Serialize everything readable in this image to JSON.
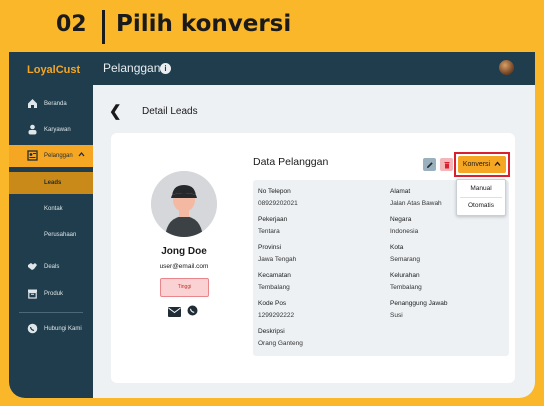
{
  "banner": {
    "step_number": "02",
    "title": "Pilih konversi"
  },
  "topbar": {
    "logo": "LoyalCust",
    "title": "Pelanggan"
  },
  "sidebar": {
    "items": [
      {
        "label": "Beranda",
        "icon": "home-icon"
      },
      {
        "label": "Karyawan",
        "icon": "users-icon"
      },
      {
        "label": "Pelanggan",
        "icon": "customer-icon"
      },
      {
        "label": "Leads",
        "icon": ""
      },
      {
        "label": "Kontak",
        "icon": ""
      },
      {
        "label": "Perusahaan",
        "icon": ""
      },
      {
        "label": "Deals",
        "icon": "handshake-icon"
      },
      {
        "label": "Produk",
        "icon": "box-icon"
      },
      {
        "label": "Hubungi Kami",
        "icon": "chat-icon"
      }
    ]
  },
  "page": {
    "title": "Detail Leads",
    "back": "❮"
  },
  "profile": {
    "name": "Jong Doe",
    "email": "user@email.com",
    "badge": "Tinggi"
  },
  "section": {
    "title": "Data Pelanggan"
  },
  "actions": {
    "convert_label": "Konversi"
  },
  "dropdown": {
    "options": [
      "Manual",
      "Otomatis"
    ]
  },
  "fields": {
    "left": [
      {
        "label": "No Telepon",
        "value": "08929202021"
      },
      {
        "label": "Pekerjaan",
        "value": "Tentara"
      },
      {
        "label": "Provinsi",
        "value": "Jawa Tengah"
      },
      {
        "label": "Kecamatan",
        "value": "Tembalang"
      },
      {
        "label": "Kode Pos",
        "value": "1299292222"
      },
      {
        "label": "Deskripsi",
        "value": "Orang Ganteng"
      }
    ],
    "right": [
      {
        "label": "Alamat",
        "value": "Jalan Atas Bawah"
      },
      {
        "label": "Negara",
        "value": "Indonesia"
      },
      {
        "label": "Kota",
        "value": "Semarang"
      },
      {
        "label": "Kelurahan",
        "value": "Tembalang"
      },
      {
        "label": "Penanggung Jawab",
        "value": "Susi"
      }
    ]
  },
  "colors": {
    "accent": "#f5a623",
    "sidebar": "#1f3d4d",
    "highlight_outline": "#d9202e",
    "banner": "#fbb72a"
  }
}
